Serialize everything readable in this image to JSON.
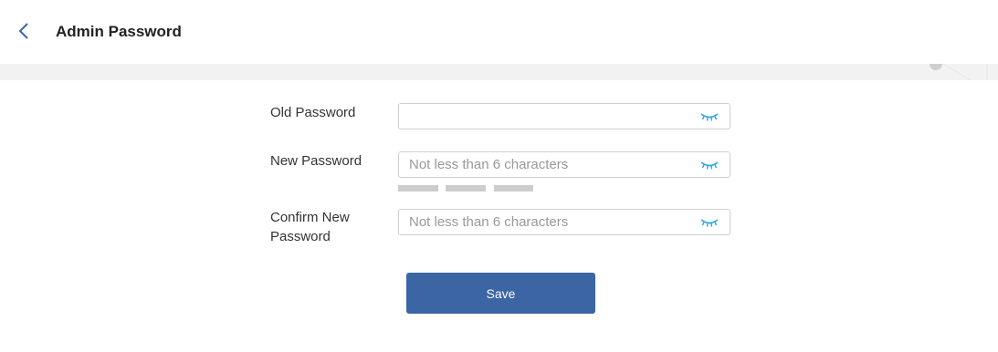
{
  "header": {
    "title": "Admin Password",
    "back_icon": "chevron-left-icon"
  },
  "form": {
    "old_password": {
      "label": "Old Password",
      "placeholder": "",
      "value": ""
    },
    "new_password": {
      "label": "New Password",
      "placeholder": "Not less than 6 characters",
      "value": ""
    },
    "confirm_password": {
      "label": "Confirm New Password",
      "label_line1": "Confirm New",
      "label_line2": "Password",
      "placeholder": "Not less than 6 characters",
      "value": ""
    },
    "strength_meter": {
      "segments": 3,
      "level": 0
    },
    "eye_icon": "eye-closed-icon"
  },
  "actions": {
    "save_label": "Save"
  },
  "colors": {
    "accent": "#3c65a4",
    "eye": "#2aa7e0",
    "band": "#f2f2f2",
    "strength_empty": "#cccccc"
  }
}
